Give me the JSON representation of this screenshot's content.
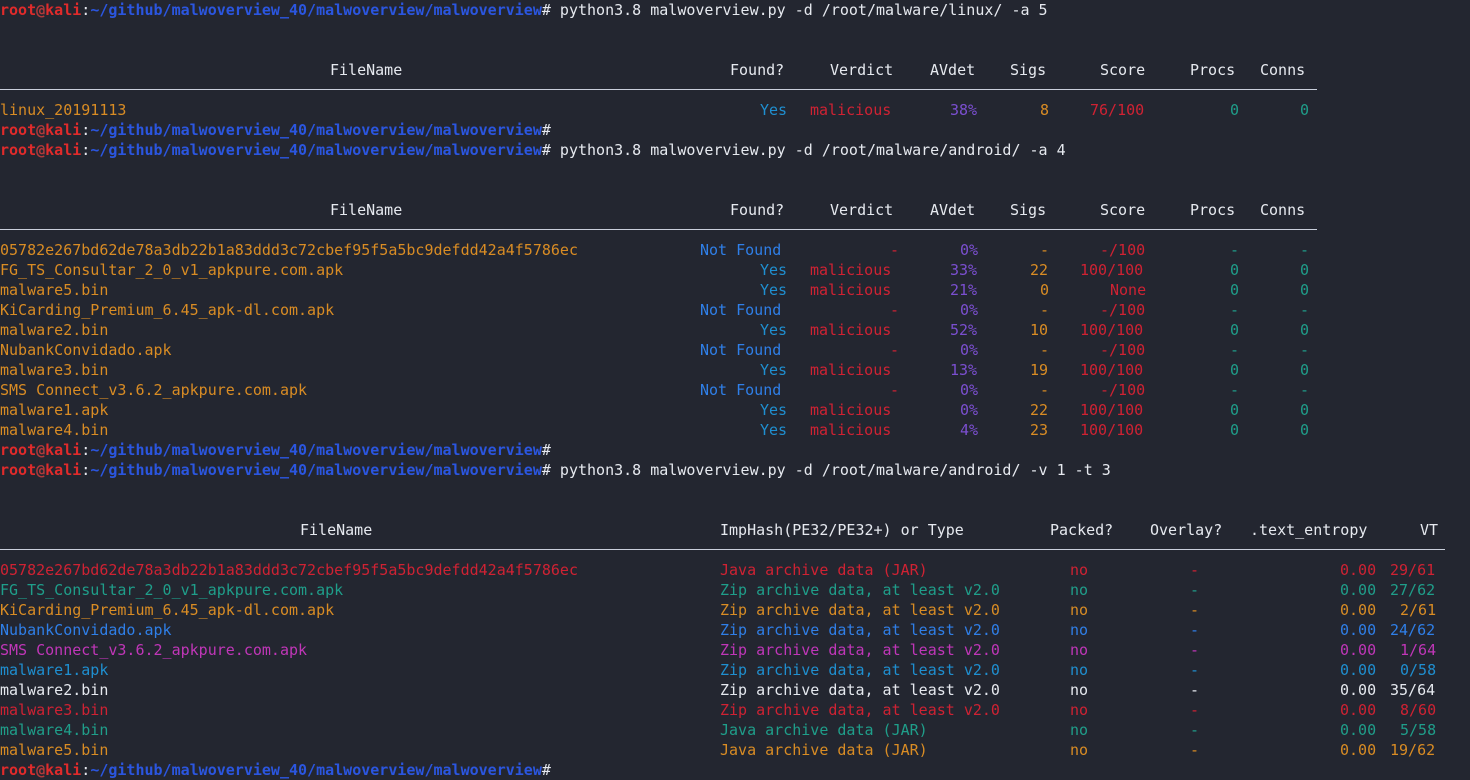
{
  "terminal": {
    "background": "#232630",
    "foreground": "#e6e9ef",
    "prompt": {
      "user": "root",
      "at": "@",
      "host": "kali",
      "colon": ":",
      "path": "~/github/malwoverview_40/malwoverview/malwoverview",
      "hash": "#"
    },
    "colors": {
      "prompt_user": "#e02b2b",
      "prompt_path": "#2b56e0",
      "red": "#cf2233",
      "orange": "#d98c24",
      "teal": "#1f9e8a",
      "blue": "#2f7fe8",
      "cyan": "#1f8fd0",
      "purple": "#7b4fd0",
      "magenta": "#c036b8",
      "white": "#e6e9ef"
    }
  },
  "commands": {
    "cmd1": " python3.8 malwoverview.py -d /root/malware/linux/ -a 5",
    "cmd2": " python3.8 malwoverview.py -d /root/malware/android/ -a 4",
    "cmd3": " python3.8 malwoverview.py -d /root/malware/android/ -v 1 -t 3"
  },
  "table1": {
    "headers": {
      "filename": "FileName",
      "found": "Found?",
      "verdict": "Verdict",
      "avdet": "AVdet",
      "sigs": "Sigs",
      "score": "Score",
      "procs": "Procs",
      "conns": "Conns"
    },
    "rows": [
      {
        "filename": "linux_20191113",
        "filename_color": "c-orange",
        "found": "Yes",
        "found_color": "c-cyan",
        "verdict": "malicious",
        "verdict_color": "c-red",
        "avdet": "38%",
        "avdet_color": "c-purple",
        "sigs": "8",
        "sigs_color": "c-orange",
        "score": "76/100",
        "score_color": "c-red",
        "procs": "0",
        "conns": "0"
      }
    ]
  },
  "table2": {
    "headers": {
      "filename": "FileName",
      "found": "Found?",
      "verdict": "Verdict",
      "avdet": "AVdet",
      "sigs": "Sigs",
      "score": "Score",
      "procs": "Procs",
      "conns": "Conns"
    },
    "rows": [
      {
        "filename": "05782e267bd62de78a3db22b1a83ddd3c72cbef95f5a5bc9defdd42a4f5786ec",
        "found": "Not Found",
        "found_color": "c-blue",
        "verdict": "-",
        "verdict_color": "c-red",
        "avdet": "0%",
        "avdet_color": "c-purple",
        "sigs": "-",
        "sigs_color": "c-orange",
        "score": "-/100",
        "score_color": "c-red",
        "procs": "-",
        "conns": "-"
      },
      {
        "filename": "FG_TS_Consultar_2_0_v1_apkpure.com.apk",
        "found": "Yes",
        "found_color": "c-cyan",
        "verdict": "malicious",
        "verdict_color": "c-red",
        "avdet": "33%",
        "avdet_color": "c-purple",
        "sigs": "22",
        "sigs_color": "c-orange",
        "score": "100/100",
        "score_color": "c-red",
        "procs": "0",
        "conns": "0"
      },
      {
        "filename": "malware5.bin",
        "found": "Yes",
        "found_color": "c-cyan",
        "verdict": "malicious",
        "verdict_color": "c-red",
        "avdet": "21%",
        "avdet_color": "c-purple",
        "sigs": "0",
        "sigs_color": "c-orange",
        "score": "None",
        "score_color": "c-red",
        "procs": "0",
        "conns": "0"
      },
      {
        "filename": "KiCarding_Premium_6.45_apk-dl.com.apk",
        "found": "Not Found",
        "found_color": "c-blue",
        "verdict": "-",
        "verdict_color": "c-red",
        "avdet": "0%",
        "avdet_color": "c-purple",
        "sigs": "-",
        "sigs_color": "c-orange",
        "score": "-/100",
        "score_color": "c-red",
        "procs": "-",
        "conns": "-"
      },
      {
        "filename": "malware2.bin",
        "found": "Yes",
        "found_color": "c-cyan",
        "verdict": "malicious",
        "verdict_color": "c-red",
        "avdet": "52%",
        "avdet_color": "c-purple",
        "sigs": "10",
        "sigs_color": "c-orange",
        "score": "100/100",
        "score_color": "c-red",
        "procs": "0",
        "conns": "0"
      },
      {
        "filename": "NubankConvidado.apk",
        "found": "Not Found",
        "found_color": "c-blue",
        "verdict": "-",
        "verdict_color": "c-red",
        "avdet": "0%",
        "avdet_color": "c-purple",
        "sigs": "-",
        "sigs_color": "c-orange",
        "score": "-/100",
        "score_color": "c-red",
        "procs": "-",
        "conns": "-"
      },
      {
        "filename": "malware3.bin",
        "found": "Yes",
        "found_color": "c-cyan",
        "verdict": "malicious",
        "verdict_color": "c-red",
        "avdet": "13%",
        "avdet_color": "c-purple",
        "sigs": "19",
        "sigs_color": "c-orange",
        "score": "100/100",
        "score_color": "c-red",
        "procs": "0",
        "conns": "0"
      },
      {
        "filename": "SMS Connect_v3.6.2_apkpure.com.apk",
        "found": "Not Found",
        "found_color": "c-blue",
        "verdict": "-",
        "verdict_color": "c-red",
        "avdet": "0%",
        "avdet_color": "c-purple",
        "sigs": "-",
        "sigs_color": "c-orange",
        "score": "-/100",
        "score_color": "c-red",
        "procs": "-",
        "conns": "-"
      },
      {
        "filename": "malware1.apk",
        "found": "Yes",
        "found_color": "c-cyan",
        "verdict": "malicious",
        "verdict_color": "c-red",
        "avdet": "0%",
        "avdet_color": "c-purple",
        "sigs": "22",
        "sigs_color": "c-orange",
        "score": "100/100",
        "score_color": "c-red",
        "procs": "0",
        "conns": "0"
      },
      {
        "filename": "malware4.bin",
        "found": "Yes",
        "found_color": "c-cyan",
        "verdict": "malicious",
        "verdict_color": "c-red",
        "avdet": "4%",
        "avdet_color": "c-purple",
        "sigs": "23",
        "sigs_color": "c-orange",
        "score": "100/100",
        "score_color": "c-red",
        "procs": "0",
        "conns": "0"
      }
    ]
  },
  "table3": {
    "headers": {
      "filename": "FileName",
      "imphash": "ImpHash(PE32/PE32+) or Type",
      "packed": "Packed?",
      "overlay": "Overlay?",
      "entropy": ".text_entropy",
      "vt": "VT"
    },
    "rows": [
      {
        "filename": "05782e267bd62de78a3db22b1a83ddd3c72cbef95f5a5bc9defdd42a4f5786ec",
        "imphash": "Java archive data (JAR)",
        "packed": "no",
        "overlay": "-",
        "entropy": "0.00",
        "vt": "29/61",
        "color": "c-red"
      },
      {
        "filename": "FG_TS_Consultar_2_0_v1_apkpure.com.apk",
        "imphash": "Zip archive data, at least v2.0",
        "packed": "no",
        "overlay": "-",
        "entropy": "0.00",
        "vt": "27/62",
        "color": "c-teal"
      },
      {
        "filename": "KiCarding_Premium_6.45_apk-dl.com.apk",
        "imphash": "Zip archive data, at least v2.0",
        "packed": "no",
        "overlay": "-",
        "entropy": "0.00",
        "vt": "2/61",
        "color": "c-orange"
      },
      {
        "filename": "NubankConvidado.apk",
        "imphash": "Zip archive data, at least v2.0",
        "packed": "no",
        "overlay": "-",
        "entropy": "0.00",
        "vt": "24/62",
        "color": "c-blue"
      },
      {
        "filename": "SMS Connect_v3.6.2_apkpure.com.apk",
        "imphash": "Zip archive data, at least v2.0",
        "packed": "no",
        "overlay": "-",
        "entropy": "0.00",
        "vt": "1/64",
        "color": "c-magenta"
      },
      {
        "filename": "malware1.apk",
        "imphash": "Zip archive data, at least v2.0",
        "packed": "no",
        "overlay": "-",
        "entropy": "0.00",
        "vt": "0/58",
        "color": "c-cyan"
      },
      {
        "filename": "malware2.bin",
        "imphash": "Zip archive data, at least v2.0",
        "packed": "no",
        "overlay": "-",
        "entropy": "0.00",
        "vt": "35/64",
        "color": "c-white"
      },
      {
        "filename": "malware3.bin",
        "imphash": "Zip archive data, at least v2.0",
        "packed": "no",
        "overlay": "-",
        "entropy": "0.00",
        "vt": "8/60",
        "color": "c-red"
      },
      {
        "filename": "malware4.bin",
        "imphash": "Java archive data (JAR)",
        "packed": "no",
        "overlay": "-",
        "entropy": "0.00",
        "vt": "5/58",
        "color": "c-teal"
      },
      {
        "filename": "malware5.bin",
        "imphash": "Java archive data (JAR)",
        "packed": "no",
        "overlay": "-",
        "entropy": "0.00",
        "vt": "19/62",
        "color": "c-orange"
      }
    ]
  }
}
